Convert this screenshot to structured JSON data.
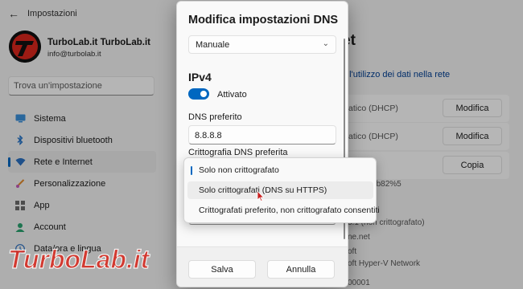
{
  "window": {
    "app_title": "Impostazioni",
    "back_icon": "back-arrow-icon"
  },
  "profile": {
    "name": "TurboLab.it TurboLab.it",
    "email": "info@turbolab.it"
  },
  "search": {
    "placeholder": "Trova un'impostazione"
  },
  "sidebar": {
    "items": [
      {
        "label": "Sistema",
        "icon": "monitor-icon",
        "active": false
      },
      {
        "label": "Dispositivi bluetooth",
        "icon": "bluetooth-icon",
        "active": false
      },
      {
        "label": "Rete e Internet",
        "icon": "wifi-icon",
        "active": true
      },
      {
        "label": "Personalizzazione",
        "icon": "brush-icon",
        "active": false
      },
      {
        "label": "App",
        "icon": "apps-icon",
        "active": false
      },
      {
        "label": "Account",
        "icon": "account-icon",
        "active": false
      },
      {
        "label": "Data/ora e lingua",
        "icon": "clock-icon",
        "active": false
      }
    ]
  },
  "main": {
    "title_fragment": "et",
    "link_fragment": "e l'utilizzo dei dati nella rete",
    "rows": [
      {
        "text": "atico (DHCP)",
        "button": "Modifica"
      },
      {
        "text": "atico (DHCP)",
        "button": "Modifica"
      },
      {
        "text": "",
        "button": "Copia"
      }
    ],
    "details": [
      "ce492:7b82%5",
      "8.1 (non crittografato)",
      "ne.net",
      "oft",
      "oft Hyper-V Network",
      "00001"
    ]
  },
  "watermark": {
    "text": "TurboLab.it"
  },
  "dialog": {
    "title": "Modifica impostazioni DNS",
    "mode_value": "Manuale",
    "section": "IPv4",
    "toggle_label": "Attivato",
    "preferred_dns_label": "DNS preferito",
    "preferred_dns_value": "8.8.8.8",
    "encryption_label": "Crittografia DNS preferita",
    "save_label": "Salva",
    "cancel_label": "Annulla"
  },
  "dropdown": {
    "options": [
      {
        "label": "Solo non crittografato",
        "selected": true
      },
      {
        "label": "Solo crittografati (DNS su HTTPS)",
        "selected": false
      },
      {
        "label": "Crittografati preferito, non crittografato consentiti",
        "selected": false
      }
    ]
  },
  "colors": {
    "accent": "#0067c0",
    "watermark_red": "#d9261c"
  }
}
